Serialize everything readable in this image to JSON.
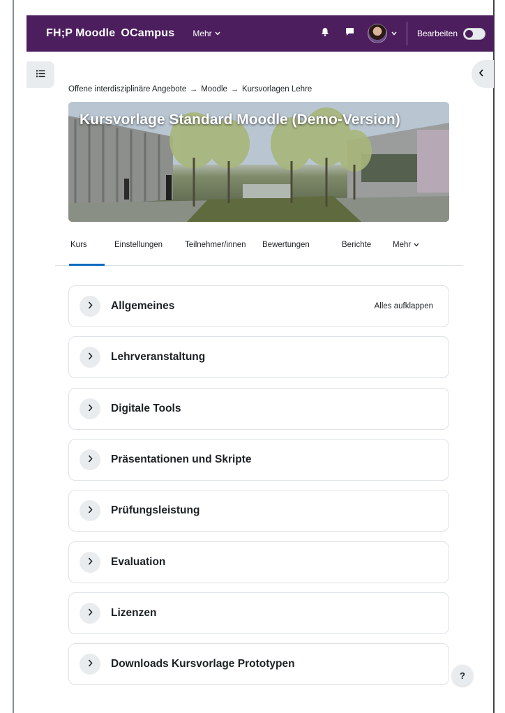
{
  "navbar": {
    "brand_short": "FH;P",
    "brand_name": "Moodle",
    "brand_campus": "OCampus",
    "more_label": "Mehr",
    "edit_mode_label": "Bearbeiten",
    "background_color": "#4c1e5e"
  },
  "breadcrumb": {
    "items": [
      "Offene interdisziplinäre Angebote",
      "Moodle",
      "Kursvorlagen Lehre"
    ],
    "separator": "→"
  },
  "course": {
    "title": "Kursvorlage Standard Moodle (Demo-Version)"
  },
  "secondary_nav": {
    "items": [
      "Kurs",
      "Einstellungen",
      "Teilnehmer/innen",
      "Bewertungen",
      "Berichte",
      "Mehr"
    ],
    "active": "Kurs",
    "accent_color": "#0f6cbf"
  },
  "sections": {
    "expand_all_label": "Alles aufklappen",
    "items": [
      "Allgemeines",
      "Lehrveranstaltung",
      "Digitale Tools",
      "Präsentationen und Skripte",
      "Prüfungsleistung",
      "Evaluation",
      "Lizenzen",
      "Downloads Kursvorlage Prototypen"
    ]
  },
  "help": {
    "label": "?"
  },
  "icons": {
    "index_drawer": "list-icon",
    "block_drawer": "chevron-left-icon",
    "notifications": "bell-icon",
    "messages": "chat-bubble-icon",
    "section_toggle": "chevron-right-icon"
  }
}
